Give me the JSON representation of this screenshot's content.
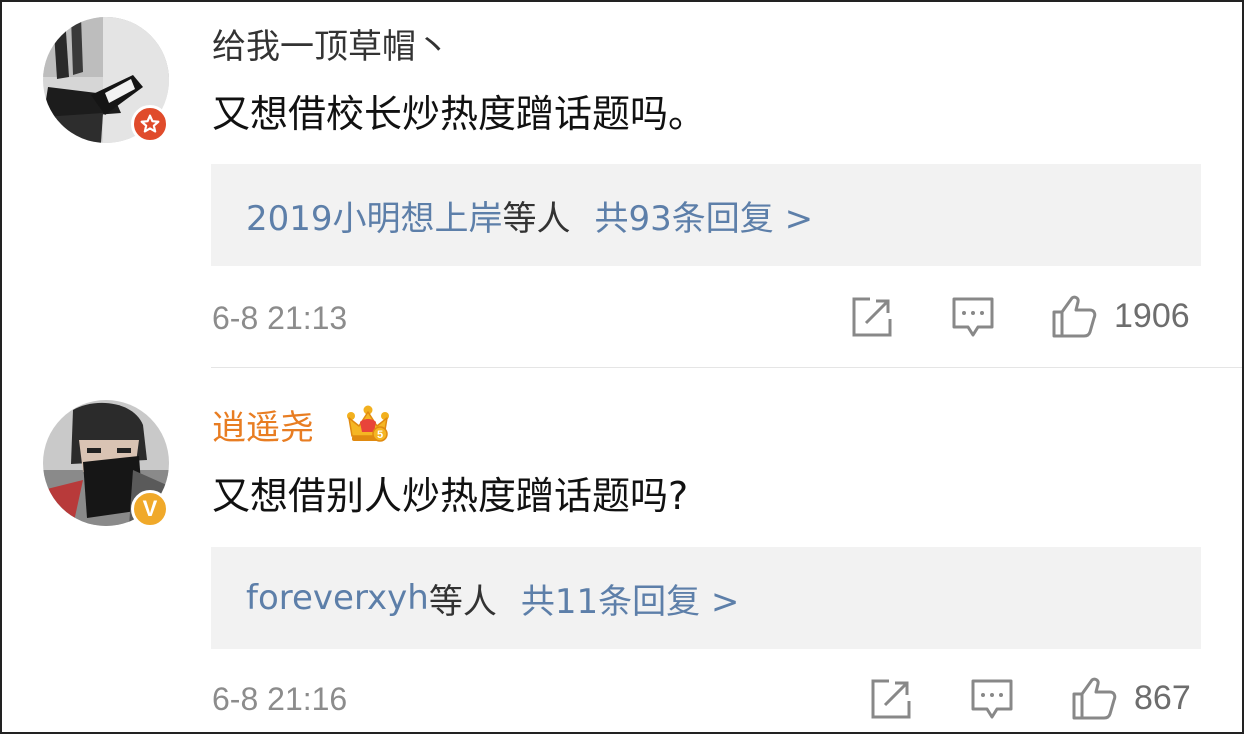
{
  "comments": [
    {
      "username": "给我一顶草帽丶",
      "text": "又想借校长炒热度蹭话题吗。",
      "reply_users": "2019小明想上岸",
      "reply_suffix": "等人",
      "reply_count": "共93条回复 >",
      "time": "6-8 21:13",
      "likes": "1906",
      "badge": "star-badge-icon"
    },
    {
      "username": "逍遥尧",
      "text": "又想借别人炒热度蹭话题吗?",
      "reply_users": "foreverxyh",
      "reply_suffix": "等人",
      "reply_count": "共11条回复 >",
      "time": "6-8 21:16",
      "likes": "867",
      "badge": "verified-v-badge-icon",
      "badge_letter": "V",
      "member_icon": "crown-icon"
    }
  ],
  "colors": {
    "link_blue": "#5d7fa9",
    "vip_orange": "#e87d22",
    "reply_bg": "#f2f2f2",
    "meta_gray": "#8c8c8c"
  }
}
